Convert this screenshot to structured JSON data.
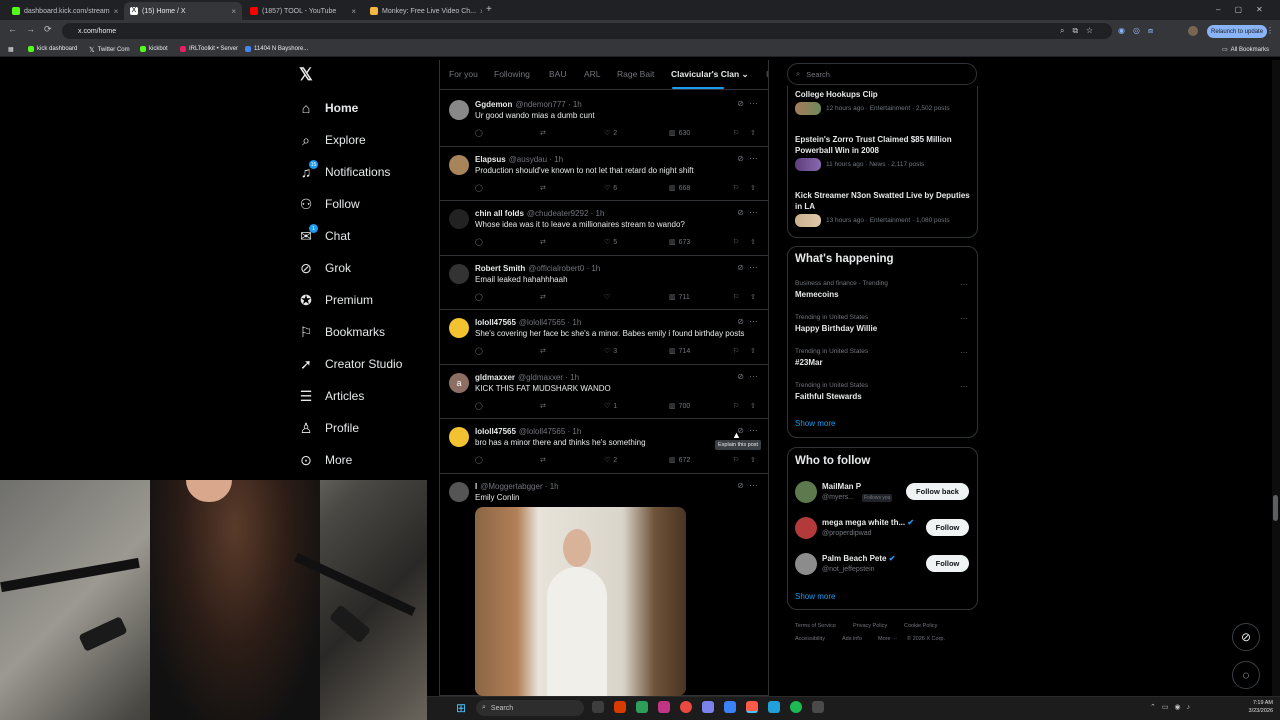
{
  "browser": {
    "tabs": [
      {
        "label": "dashboard.kick.com/stream",
        "color": "#53fc18"
      },
      {
        "label": "(15) Home / X",
        "color": "#ffffff"
      },
      {
        "label": "(1857) TOOL - YouTube",
        "color": "#ff0000"
      },
      {
        "label": "Monkey: Free Live Video Ch...",
        "color": "#f5b642"
      }
    ],
    "new_tab": "+",
    "url": "x.com/home",
    "relaunch": "Relaunch to update",
    "bookmarks": [
      "kick dashboard",
      "Twitter Com",
      "kickbot",
      "IRLToolkit • Server",
      "11404 N Bayshore..."
    ],
    "all_bookmarks": "All Bookmarks"
  },
  "nav": {
    "items": [
      {
        "label": "Home"
      },
      {
        "label": "Explore"
      },
      {
        "label": "Notifications",
        "badge": "15"
      },
      {
        "label": "Follow"
      },
      {
        "label": "Chat",
        "badge": "1"
      },
      {
        "label": "Grok"
      },
      {
        "label": "Premium"
      },
      {
        "label": "Bookmarks"
      },
      {
        "label": "Creator Studio"
      },
      {
        "label": "Articles"
      },
      {
        "label": "Profile"
      },
      {
        "label": "More"
      }
    ]
  },
  "feed_tabs": [
    "For you",
    "Following",
    "BAU",
    "ARL",
    "Rage Bait",
    "Clavicular's Clan",
    "I"
  ],
  "posts": [
    {
      "name": "Ggdemon",
      "handle": "@ndemon777 · 1h",
      "text": "Ur good wando mias a dumb cunt",
      "likes": "2",
      "views": "630",
      "av": "#888"
    },
    {
      "name": "Elapsus",
      "handle": "@ausydau · 1h",
      "text": "Production should've known to not let that retard do night shift",
      "likes": "6",
      "views": "668",
      "av": "#a8845a"
    },
    {
      "name": "chin all folds",
      "handle": "@chudeater9292 · 1h",
      "text": "Whose idea was it to leave a millionaires stream to wando?",
      "likes": "5",
      "views": "673",
      "av": "#222"
    },
    {
      "name": "Robert Smith",
      "handle": "@officialrobert0 · 1h",
      "text": "Email leaked hahahhhaah",
      "likes": "",
      "views": "711",
      "av": "#333"
    },
    {
      "name": "lololl47565",
      "handle": "@lololl47565 · 1h",
      "text": "She's covering her face bc she's a minor. Babes emily i found birthday posts",
      "likes": "3",
      "views": "714",
      "av": "#f2c230"
    },
    {
      "name": "gldmaxxer",
      "handle": "@gldmaxxer · 1h",
      "text": "KICK THIS FAT MUDSHARK WANDO",
      "likes": "1",
      "views": "700",
      "av": "#8d6e63",
      "letter": "a"
    },
    {
      "name": "lololl47565",
      "handle": "@lololl47565 · 1h",
      "text": "bro has a minor there and thinks he's something",
      "likes": "2",
      "views": "672",
      "av": "#f2c230"
    },
    {
      "name": "l",
      "handle": "@Moggertabgger · 1h",
      "text": "Emily Conlin",
      "likes": "",
      "views": "",
      "av": "#555"
    }
  ],
  "tooltip": "Explain this post",
  "search": {
    "placeholder": "Search"
  },
  "trends_top": [
    {
      "title": "College Hookups Clip",
      "meta": ""
    },
    {
      "title": "Epstein's Zorro Trust Claimed $85 Million Powerball Win in 2008",
      "meta": "11 hours ago · News · 2,117 posts"
    },
    {
      "title": "Kick Streamer N3on Swatted Live by Deputies in LA",
      "meta": "13 hours ago · Entertainment · 1,080 posts"
    }
  ],
  "trends_top_first_meta": "12 hours ago · Entertainment · 2,502 posts",
  "whats_happening": {
    "title": "What's happening",
    "items": [
      {
        "meta": "Business and finance · Trending",
        "title": "Memecoins"
      },
      {
        "meta": "Trending in United States",
        "title": "Happy Birthday Willie"
      },
      {
        "meta": "Trending in United States",
        "title": "#23Mar"
      },
      {
        "meta": "Trending in United States",
        "title": "Faithful Stewards"
      }
    ],
    "show_more": "Show more"
  },
  "who_to_follow": {
    "title": "Who to follow",
    "people": [
      {
        "name": "MailMan P",
        "handle": "@myers...",
        "badge": "Follows you",
        "button": "Follow back"
      },
      {
        "name": "mega mega white th...",
        "handle": "@properdipwad",
        "badge": "",
        "button": "Follow"
      },
      {
        "name": "Palm Beach Pete",
        "handle": "@not_jeffepstein",
        "badge": "",
        "button": "Follow"
      }
    ],
    "show_more": "Show more"
  },
  "footer": {
    "row1": [
      "Terms of Service",
      "Privacy Policy",
      "Cookie Policy"
    ],
    "row2": [
      "Accessibility",
      "Ads info",
      "More ···",
      "© 2026 X Corp."
    ]
  },
  "taskbar": {
    "search": "Search",
    "time": "7:19 AM",
    "date": "3/23/2026"
  }
}
